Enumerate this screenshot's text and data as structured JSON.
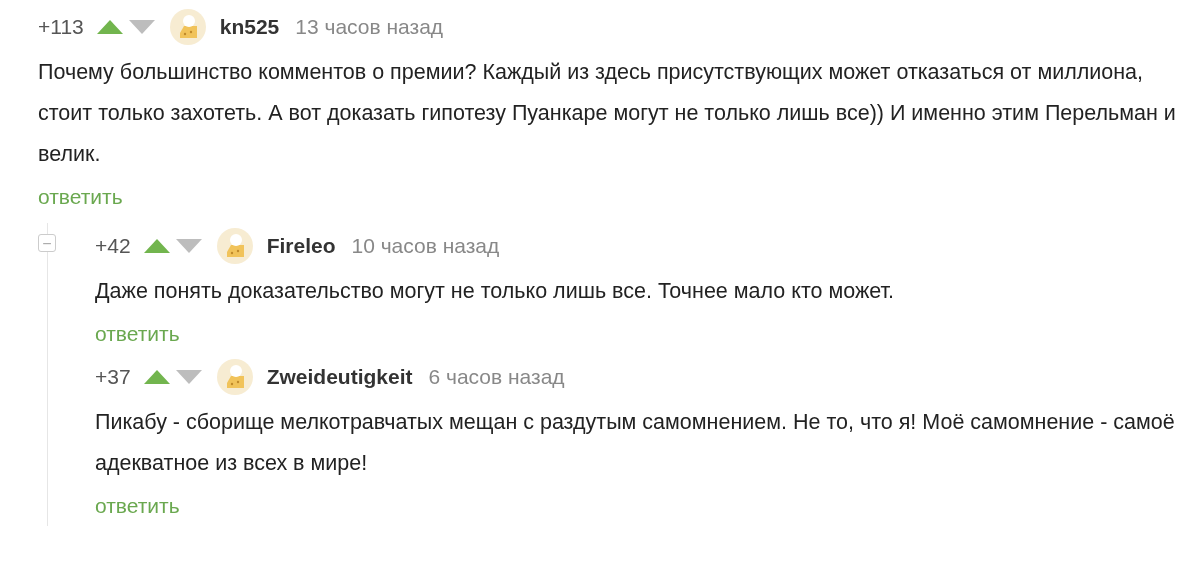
{
  "comments": [
    {
      "rating": "+113",
      "author": "kn525",
      "time": "13 часов назад",
      "text": "Почему большинство комментов о премии? Каждый из здесь присутствующих может отказаться от миллиона, стоит только захотеть. А вот доказать гипотезу Пуанкаре могут не только лишь все)) И именно этим Перельман и велик.",
      "reply": "ответить",
      "children": [
        {
          "rating": "+42",
          "author": "Fireleo",
          "time": "10 часов назад",
          "text": "Даже понять доказательство могут не только лишь все. Точнее мало кто может.",
          "reply": "ответить",
          "collapse": "−",
          "children": [
            {
              "rating": "+37",
              "author": "Zweideutigkeit",
              "time": "6 часов назад",
              "text": "Пикабу - сборище мелкотравчатых мещан с раздутым самомнением. Не то, что я! Моё самомнение - самоё адекватное из всех в мире!",
              "reply": "ответить"
            }
          ]
        }
      ]
    }
  ]
}
